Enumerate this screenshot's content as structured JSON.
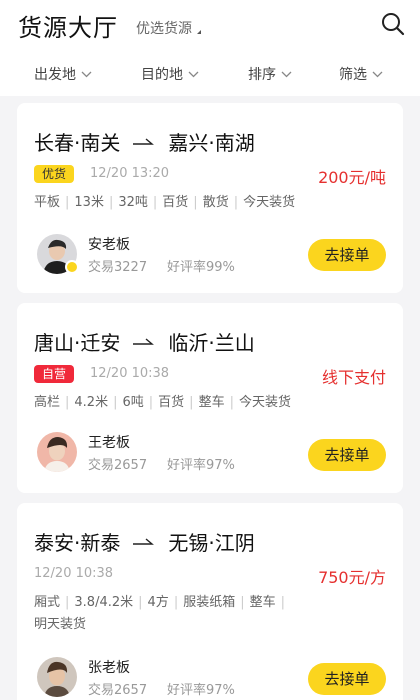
{
  "header": {
    "title": "货源大厅",
    "subtitle": "优选货源"
  },
  "filters": [
    {
      "label": "出发地"
    },
    {
      "label": "目的地"
    },
    {
      "label": "排序"
    },
    {
      "label": "筛选"
    }
  ],
  "cards": [
    {
      "from": "长春·南关",
      "to": "嘉兴·南湖",
      "badge": "优货",
      "time": "12/20 13:20",
      "price": "200元/吨",
      "tags": [
        "平板",
        "13米",
        "32吨",
        "百货",
        "散货",
        "今天装货"
      ],
      "owner": {
        "name": "安老板",
        "deals": "交易3227",
        "rating": "好评率99%"
      },
      "action": "去接单"
    },
    {
      "from": "唐山·迁安",
      "to": "临沂·兰山",
      "badge": "自营",
      "time": "12/20 10:38",
      "price": "线下支付",
      "tags": [
        "高栏",
        "4.2米",
        "6吨",
        "百货",
        "整车",
        "今天装货"
      ],
      "owner": {
        "name": "王老板",
        "deals": "交易2657",
        "rating": "好评率97%"
      },
      "action": "去接单"
    },
    {
      "from": "泰安·新泰",
      "to": "无锡·江阴",
      "time": "12/20 10:38",
      "price": "750元/方",
      "tags": [
        "厢式",
        "3.8/4.2米",
        "4方",
        "服装纸箱",
        "整车",
        "明天装货"
      ],
      "owner": {
        "name": "张老板",
        "deals": "交易2657",
        "rating": "好评率97%"
      },
      "action": "去接单"
    }
  ],
  "colors": {
    "accent": "#fbd51e",
    "price": "#e5302f",
    "badge_red": "#f0293a",
    "background": "#f4f4f6"
  }
}
